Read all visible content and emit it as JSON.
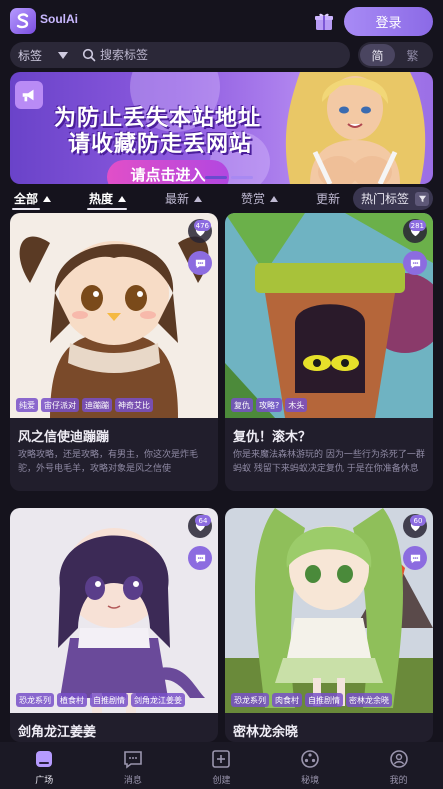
{
  "app": {
    "logo_text": "SoulAi",
    "login_label": "登录"
  },
  "search": {
    "tag_label": "标签",
    "placeholder": "搜索标签"
  },
  "lang": {
    "simplified": "简",
    "traditional": "繁",
    "active": "simplified"
  },
  "banner": {
    "line1": "为防止丢失本站地址",
    "line2": "请收藏防走丢网站",
    "cta": "请点击进入"
  },
  "sort": {
    "items": [
      {
        "label": "全部",
        "arrow": false
      },
      {
        "label": "热度",
        "arrow": true
      },
      {
        "label": "最新",
        "arrow": true
      },
      {
        "label": "赞赏",
        "arrow": true
      },
      {
        "label": "更新",
        "arrow": false
      }
    ],
    "active_index": 1,
    "hot_tags_label": "热门标签"
  },
  "cards": [
    {
      "title": "风之信使迪蹦蹦",
      "desc": "攻略攻略，还是攻略，有男主，你这次是炸毛驼，外号电毛羊，攻略对象是风之信使",
      "count": "476",
      "tags": [
        "纯爱",
        "宙仔派对",
        "迪蹦蹦",
        "神奇艾比"
      ]
    },
    {
      "title": "复仇！滚木？",
      "desc": "你是来魔法森林游玩的 因为一些行为杀死了一群蚂蚁 残留下来蚂蚁决定复仇 于是在你准备休息的时候 一个木头桩子滚到你身边....",
      "count": "281",
      "tags": [
        "复仇",
        "攻略?",
        "木头"
      ]
    },
    {
      "title": "剑角龙江姜姜",
      "desc": "",
      "count": "64",
      "tags": [
        "恐龙系列",
        "植食村",
        "自推剧情",
        "剑角龙江姜姜"
      ]
    },
    {
      "title": "密林龙余晓",
      "desc": "",
      "count": "60",
      "tags": [
        "恐龙系列",
        "肉食村",
        "自推剧情",
        "密林龙余晓"
      ]
    }
  ],
  "nav": [
    {
      "label": "广场",
      "icon": "square-icon",
      "active": true
    },
    {
      "label": "消息",
      "icon": "message-icon",
      "active": false
    },
    {
      "label": "创建",
      "icon": "create-icon",
      "active": false
    },
    {
      "label": "秘境",
      "icon": "realm-icon",
      "active": false
    },
    {
      "label": "我的",
      "icon": "profile-icon",
      "active": false
    }
  ],
  "colors": {
    "accent": "#8c6ce0",
    "background": "#15131d",
    "card": "#211e2c"
  }
}
